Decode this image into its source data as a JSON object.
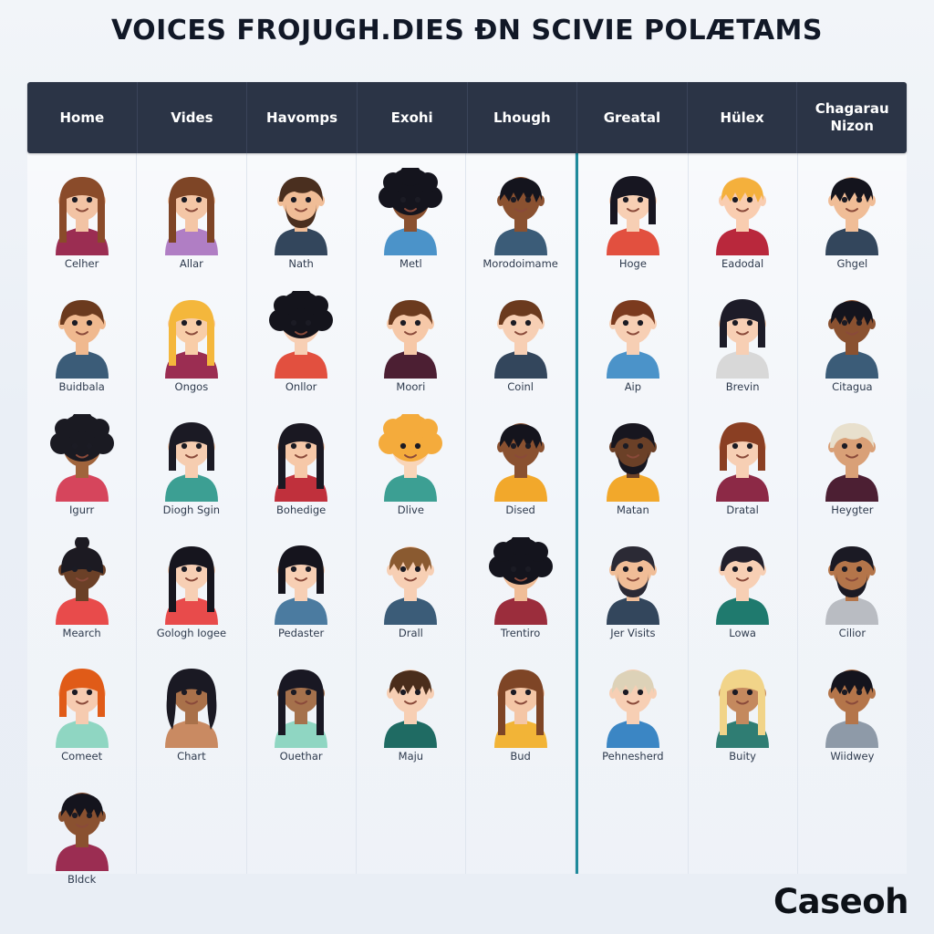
{
  "header": {
    "title": "VOICES FROJUGH.DIES ÐN SCIVIE POLÆTAMS"
  },
  "nav": {
    "items": [
      {
        "label": "Home"
      },
      {
        "label": "Vides"
      },
      {
        "label": "Havomps"
      },
      {
        "label": "Exohi"
      },
      {
        "label": "Lhough"
      },
      {
        "label": "Greatal"
      },
      {
        "label": "Hülex"
      },
      {
        "label": "Chagarau Nizon"
      }
    ]
  },
  "footer": {
    "brand": "Caseoh"
  },
  "colors": {
    "page_background": "#eef2f7",
    "navbar_background": "#2b3446",
    "navbar_text": "#ffffff",
    "title_text": "#111827",
    "label_text": "#2e3a4d",
    "column_divider": "#dfe5ee",
    "accent_divider": "#1f8a9b",
    "brand_text": "#0d1117"
  },
  "grid": {
    "accent_divider_before_column": 5,
    "columns": [
      {
        "header": "Home",
        "cells": [
          {
            "name": "Celher",
            "icon": "avatar-icon",
            "skin": "#f2c3a4",
            "hair": "#8a4b2a",
            "shirt": "#9b2d52",
            "style": "long-straight",
            "facial": "none"
          },
          {
            "name": "Buidbala",
            "icon": "avatar-icon",
            "skin": "#f0b98f",
            "hair": "#6b3a1e",
            "shirt": "#3b5c78",
            "style": "short-wavy",
            "facial": "none"
          },
          {
            "name": "Igurr",
            "icon": "avatar-icon",
            "skin": "#a0643c",
            "hair": "#1a1a22",
            "shirt": "#d6455c",
            "style": "afro-curly",
            "facial": "none"
          },
          {
            "name": "Mearch",
            "icon": "avatar-icon",
            "skin": "#6b4027",
            "hair": "#1c1a22",
            "shirt": "#e84b4b",
            "style": "top-bun",
            "facial": "none"
          },
          {
            "name": "Comeet",
            "icon": "avatar-icon",
            "skin": "#f6cbb0",
            "hair": "#e05b18",
            "shirt": "#8fd6c2",
            "style": "bob",
            "facial": "none"
          },
          {
            "name": "Bldck",
            "icon": "avatar-icon",
            "skin": "#8a5130",
            "hair": "#14141d",
            "shirt": "#9b2d52",
            "style": "short-spiky",
            "facial": "none"
          }
        ]
      },
      {
        "header": "Vides",
        "cells": [
          {
            "name": "Allar",
            "icon": "avatar-icon",
            "skin": "#f4c6a6",
            "hair": "#7e4526",
            "shirt": "#b07ec4",
            "style": "long-straight",
            "facial": "none"
          },
          {
            "name": "Ongos",
            "icon": "avatar-icon",
            "skin": "#f8cda8",
            "hair": "#f4b73c",
            "shirt": "#9b2d52",
            "style": "long-straight",
            "facial": "none"
          },
          {
            "name": "Diogh Sgin",
            "icon": "avatar-icon",
            "skin": "#f6cdb0",
            "hair": "#1b1a24",
            "shirt": "#3c9f93",
            "style": "bob",
            "facial": "none"
          },
          {
            "name": "Gologh Iogee",
            "icon": "avatar-icon",
            "skin": "#f7cfb4",
            "hair": "#16151e",
            "shirt": "#e84b4b",
            "style": "long-straight",
            "facial": "none"
          },
          {
            "name": "Chart",
            "icon": "avatar-icon",
            "skin": "#a9714a",
            "hair": "#1a1923",
            "shirt": "#c98a62",
            "style": "long-wavy",
            "facial": "none"
          },
          {
            "name": "",
            "icon": "none",
            "skin": "",
            "hair": "",
            "shirt": "",
            "style": "",
            "facial": "none"
          }
        ]
      },
      {
        "header": "Havomps",
        "cells": [
          {
            "name": "Nath",
            "icon": "avatar-icon",
            "skin": "#f0bd97",
            "hair": "#4a2f1f",
            "shirt": "#33465c",
            "style": "short-wavy",
            "facial": "beard"
          },
          {
            "name": "Onllor",
            "icon": "avatar-icon",
            "skin": "#f7cfb4",
            "hair": "#14141c",
            "shirt": "#e2503f",
            "style": "afro-curly",
            "facial": "none"
          },
          {
            "name": "Bohedige",
            "icon": "avatar-icon",
            "skin": "#f6c8a8",
            "hair": "#1a1822",
            "shirt": "#c0303c",
            "style": "long-straight",
            "facial": "none"
          },
          {
            "name": "Pedaster",
            "icon": "avatar-icon",
            "skin": "#f7cfb4",
            "hair": "#15141d",
            "shirt": "#4b7ba0",
            "style": "bob",
            "facial": "none"
          },
          {
            "name": "Ouethar",
            "icon": "avatar-icon",
            "skin": "#a5714c",
            "hair": "#191823",
            "shirt": "#8fd6c2",
            "style": "long-straight",
            "facial": "none"
          },
          {
            "name": "",
            "icon": "none",
            "skin": "",
            "hair": "",
            "shirt": "",
            "style": "",
            "facial": "none"
          }
        ]
      },
      {
        "header": "Exohi",
        "cells": [
          {
            "name": "Metl",
            "icon": "avatar-icon",
            "skin": "#8a5130",
            "hair": "#14141d",
            "shirt": "#4b93c9",
            "style": "afro-curly",
            "facial": "none"
          },
          {
            "name": "Moori",
            "icon": "avatar-icon",
            "skin": "#f6c8a8",
            "hair": "#6b3a1e",
            "shirt": "#4c1f33",
            "style": "short-wavy",
            "facial": "none"
          },
          {
            "name": "Dlive",
            "icon": "avatar-icon",
            "skin": "#f9d5b8",
            "hair": "#f4ab3c",
            "shirt": "#3c9f93",
            "style": "afro-curly",
            "facial": "none"
          },
          {
            "name": "Drall",
            "icon": "avatar-icon",
            "skin": "#f7cfb4",
            "hair": "#8a5a30",
            "shirt": "#3b5c78",
            "style": "short-spiky",
            "facial": "none"
          },
          {
            "name": "Maju",
            "icon": "avatar-icon",
            "skin": "#f7cfb4",
            "hair": "#4a2d1b",
            "shirt": "#1f6b63",
            "style": "short-spiky",
            "facial": "none"
          },
          {
            "name": "",
            "icon": "none",
            "skin": "",
            "hair": "",
            "shirt": "",
            "style": "",
            "facial": "none"
          }
        ]
      },
      {
        "header": "Lhough",
        "cells": [
          {
            "name": "Morodoimame",
            "icon": "avatar-icon",
            "skin": "#8a5130",
            "hair": "#14141d",
            "shirt": "#3b5c78",
            "style": "short-spiky",
            "facial": "none"
          },
          {
            "name": "Coinl",
            "icon": "avatar-icon",
            "skin": "#f7cfb4",
            "hair": "#6b3a1e",
            "shirt": "#33465c",
            "style": "short-wavy",
            "facial": "none"
          },
          {
            "name": "Dised",
            "icon": "avatar-icon",
            "skin": "#8a5130",
            "hair": "#14141d",
            "shirt": "#f2a82b",
            "style": "short-spiky",
            "facial": "none"
          },
          {
            "name": "Trentiro",
            "icon": "avatar-icon",
            "skin": "#f0bd97",
            "hair": "#14141d",
            "shirt": "#9b2d3c",
            "style": "afro-curly",
            "facial": "none"
          },
          {
            "name": "Bud",
            "icon": "avatar-icon",
            "skin": "#f4c6a6",
            "hair": "#7e4526",
            "shirt": "#f2b437",
            "style": "long-straight",
            "facial": "none"
          },
          {
            "name": "",
            "icon": "none",
            "skin": "",
            "hair": "",
            "shirt": "",
            "style": "",
            "facial": "none"
          }
        ]
      },
      {
        "header": "Greatal",
        "cells": [
          {
            "name": "Hoge",
            "icon": "avatar-icon",
            "skin": "#f7cfb4",
            "hair": "#171621",
            "shirt": "#e2503f",
            "style": "bob",
            "facial": "none"
          },
          {
            "name": "Aip",
            "icon": "avatar-icon",
            "skin": "#f7cfb4",
            "hair": "#7b3a1e",
            "shirt": "#4b93c9",
            "style": "short-wavy",
            "facial": "none"
          },
          {
            "name": "Matan",
            "icon": "avatar-icon",
            "skin": "#6b4027",
            "hair": "#17161f",
            "shirt": "#f2a82b",
            "style": "short-wavy",
            "facial": "beard"
          },
          {
            "name": "Jer Visits",
            "icon": "avatar-icon",
            "skin": "#f0bd97",
            "hair": "#2b2a35",
            "shirt": "#33465c",
            "style": "short-wavy",
            "facial": "beard"
          },
          {
            "name": "Pehnesherd",
            "icon": "avatar-icon",
            "skin": "#f7cfb4",
            "hair": "#ddd2b8",
            "shirt": "#3b86c4",
            "style": "short-spiky",
            "facial": "none"
          },
          {
            "name": "",
            "icon": "none",
            "skin": "",
            "hair": "",
            "shirt": "",
            "style": "",
            "facial": "none"
          }
        ]
      },
      {
        "header": "Hülex",
        "cells": [
          {
            "name": "Eadodal",
            "icon": "avatar-icon",
            "skin": "#f9cdb0",
            "hair": "#f4b03c",
            "shirt": "#b9283c",
            "style": "short-spiky",
            "facial": "none"
          },
          {
            "name": "Brevin",
            "icon": "avatar-icon",
            "skin": "#f7cfb4",
            "hair": "#1d1c28",
            "shirt": "#d8d8d8",
            "style": "bob",
            "facial": "none"
          },
          {
            "name": "Dratal",
            "icon": "avatar-icon",
            "skin": "#f7cfb4",
            "hair": "#8a3f23",
            "shirt": "#8c2946",
            "style": "bob",
            "facial": "none"
          },
          {
            "name": "Lowa",
            "icon": "avatar-icon",
            "skin": "#f7cfb4",
            "hair": "#221f2b",
            "shirt": "#1f7a6e",
            "style": "short-wavy",
            "facial": "none"
          },
          {
            "name": "Buity",
            "icon": "avatar-icon",
            "skin": "#c4895e",
            "hair": "#f1d489",
            "shirt": "#2f7d73",
            "style": "long-straight",
            "facial": "none"
          },
          {
            "name": "",
            "icon": "none",
            "skin": "",
            "hair": "",
            "shirt": "",
            "style": "",
            "facial": "none"
          }
        ]
      },
      {
        "header": "Chagarau Nizon",
        "cells": [
          {
            "name": "Ghgel",
            "icon": "avatar-icon",
            "skin": "#f0bd97",
            "hair": "#14141d",
            "shirt": "#33465c",
            "style": "short-spiky",
            "facial": "none"
          },
          {
            "name": "Citagua",
            "icon": "avatar-icon",
            "skin": "#8a5130",
            "hair": "#14141d",
            "shirt": "#3b5c78",
            "style": "short-spiky",
            "facial": "none"
          },
          {
            "name": "Heygter",
            "icon": "avatar-icon",
            "skin": "#d9a077",
            "hair": "#e8e0cd",
            "shirt": "#4c1f33",
            "style": "short-wavy",
            "facial": "none"
          },
          {
            "name": "Cilior",
            "icon": "avatar-icon",
            "skin": "#b4754a",
            "hair": "#1b1a24",
            "shirt": "#b9bcc2",
            "style": "short-wavy",
            "facial": "beard"
          },
          {
            "name": "Wiidwey",
            "icon": "avatar-icon",
            "skin": "#b4754a",
            "hair": "#14141d",
            "shirt": "#8e9aa8",
            "style": "short-spiky",
            "facial": "none"
          },
          {
            "name": "",
            "icon": "none",
            "skin": "",
            "hair": "",
            "shirt": "",
            "style": "",
            "facial": "none"
          }
        ]
      }
    ]
  }
}
